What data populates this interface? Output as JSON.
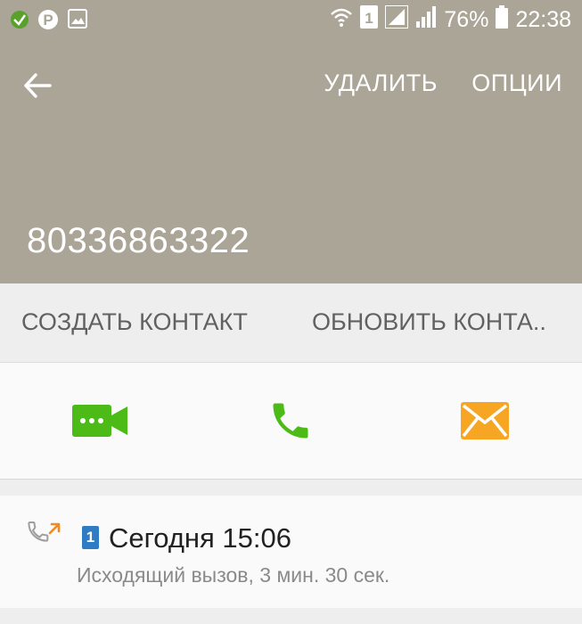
{
  "status_bar": {
    "battery": "76%",
    "time": "22:38",
    "sim_slot": "1",
    "icons": [
      "leaf-notification-icon",
      "pinterest-icon",
      "gallery-icon",
      "wifi-icon",
      "sim-1-icon",
      "signal-icon",
      "signal-2-icon",
      "battery-icon"
    ]
  },
  "toolbar": {
    "delete_label": "УДАЛИТЬ",
    "options_label": "ОПЦИИ"
  },
  "contact": {
    "phone_number": "80336863322"
  },
  "contact_actions": {
    "create_label": "СОЗДАТЬ КОНТАКТ",
    "update_label": "ОБНОВИТЬ КОНТА.."
  },
  "communication": {
    "video_icon": "video-call-icon",
    "call_icon": "phone-icon",
    "message_icon": "envelope-icon"
  },
  "call_log": [
    {
      "sim": "1",
      "date": "Сегодня 15:06",
      "details": "Исходящий вызов, 3 мин. 30 сек.",
      "direction": "outgoing"
    }
  ],
  "colors": {
    "header": "#aba597",
    "video": "#4cbb17",
    "call": "#4cbb17",
    "message": "#f6a623",
    "outgoing_arrow": "#f08a24",
    "sim_badge": "#2f7cc4"
  }
}
